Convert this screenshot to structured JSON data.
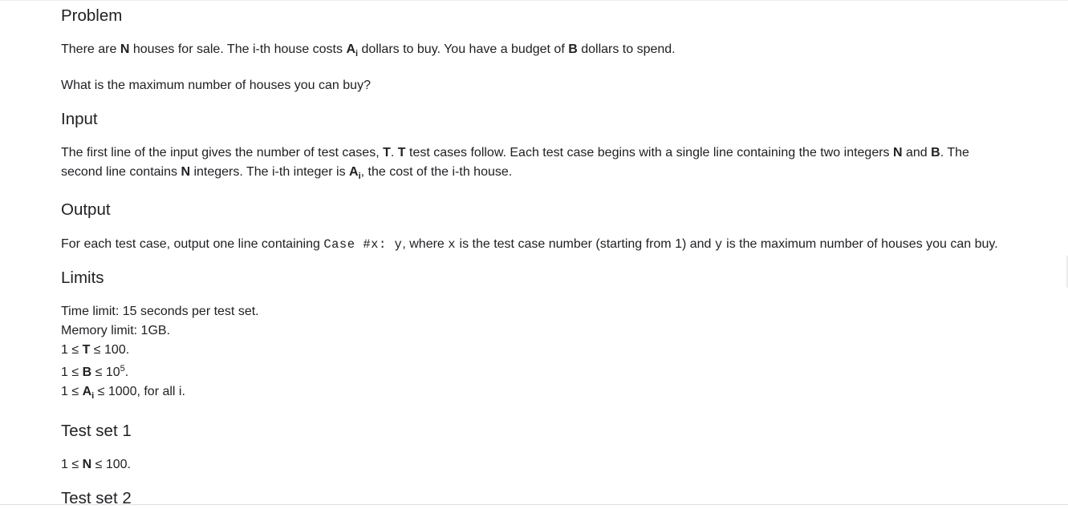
{
  "sections": {
    "problem": {
      "heading": "Problem",
      "p1": {
        "t1": "There are ",
        "n": "N",
        "t2": " houses for sale. The i-th house costs ",
        "a": "A",
        "a_sub": "i",
        "t3": " dollars to buy. You have a budget of ",
        "b": "B",
        "t4": " dollars to spend."
      },
      "p2": "What is the maximum number of houses you can buy?"
    },
    "input": {
      "heading": "Input",
      "line1": {
        "t1": "The first line of the input gives the number of test cases, ",
        "t_var": "T",
        "t2": ". ",
        "t_var2": "T",
        "t3": " test cases follow. Each test case begins with a single line containing the two integers ",
        "n": "N",
        "t4": " and ",
        "b": "B",
        "t5": ". The"
      },
      "line2": {
        "t1": "second line contains ",
        "n": "N",
        "t2": " integers. The i-th integer is ",
        "a": "A",
        "a_sub": "i",
        "t3": ", the cost of the i-th house."
      }
    },
    "output": {
      "heading": "Output",
      "t1": "For each test case, output one line containing ",
      "code_case": "Case #x: y",
      "t2": ", where ",
      "code_x": "x",
      "t3": " is the test case number (starting from 1) and ",
      "code_y": "y",
      "t4": " is the maximum number of houses you can buy."
    },
    "limits": {
      "heading": "Limits",
      "time": "Time limit: 15 seconds per test set.",
      "memory": "Memory limit: 1GB.",
      "t_limit": {
        "pre": "1 ≤ ",
        "var": "T",
        "post": " ≤ 100."
      },
      "b_limit": {
        "pre": "1 ≤ ",
        "var": "B",
        "mid": " ≤ 10",
        "sup": "5",
        "post": "."
      },
      "a_limit": {
        "pre": "1 ≤ ",
        "var": "A",
        "sub": "i",
        "post": " ≤ 1000, for all i."
      }
    },
    "test_set_1": {
      "heading": "Test set 1",
      "n_limit": {
        "pre": "1 ≤ ",
        "var": "N",
        "post": " ≤ 100."
      }
    },
    "test_set_2": {
      "heading": "Test set 2"
    }
  }
}
